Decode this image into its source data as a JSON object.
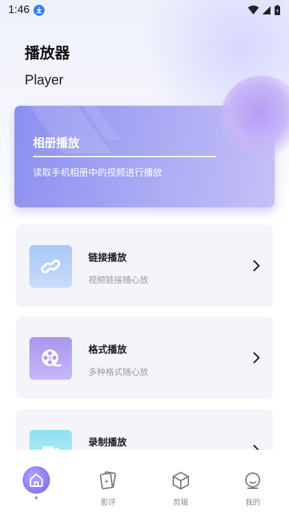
{
  "status_bar": {
    "time": "1:46"
  },
  "header": {
    "title_cn": "播放器",
    "title_en": "Player"
  },
  "hero": {
    "title": "相册播放",
    "subtitle": "读取手机相册中的视频进行播放"
  },
  "cards": [
    {
      "title": "链接播放",
      "subtitle": "视频链接随心放",
      "icon": "link-icon"
    },
    {
      "title": "格式播放",
      "subtitle": "多种格式随心放",
      "icon": "film-reel-icon"
    },
    {
      "title": "录制播放",
      "subtitle": "",
      "icon": "video-icon"
    }
  ],
  "nav": {
    "items": [
      {
        "label": "",
        "icon": "home-icon",
        "active": true
      },
      {
        "label": "影评",
        "icon": "cards-icon"
      },
      {
        "label": "剪辑",
        "icon": "cube-icon"
      },
      {
        "label": "我的",
        "icon": "profile-icon"
      }
    ]
  },
  "colors": {
    "accent": "#8f7cf0",
    "hero_gradient_start": "#8d8ff0",
    "hero_gradient_end": "#c6c0f7",
    "card_bg": "#f4f5fa"
  }
}
